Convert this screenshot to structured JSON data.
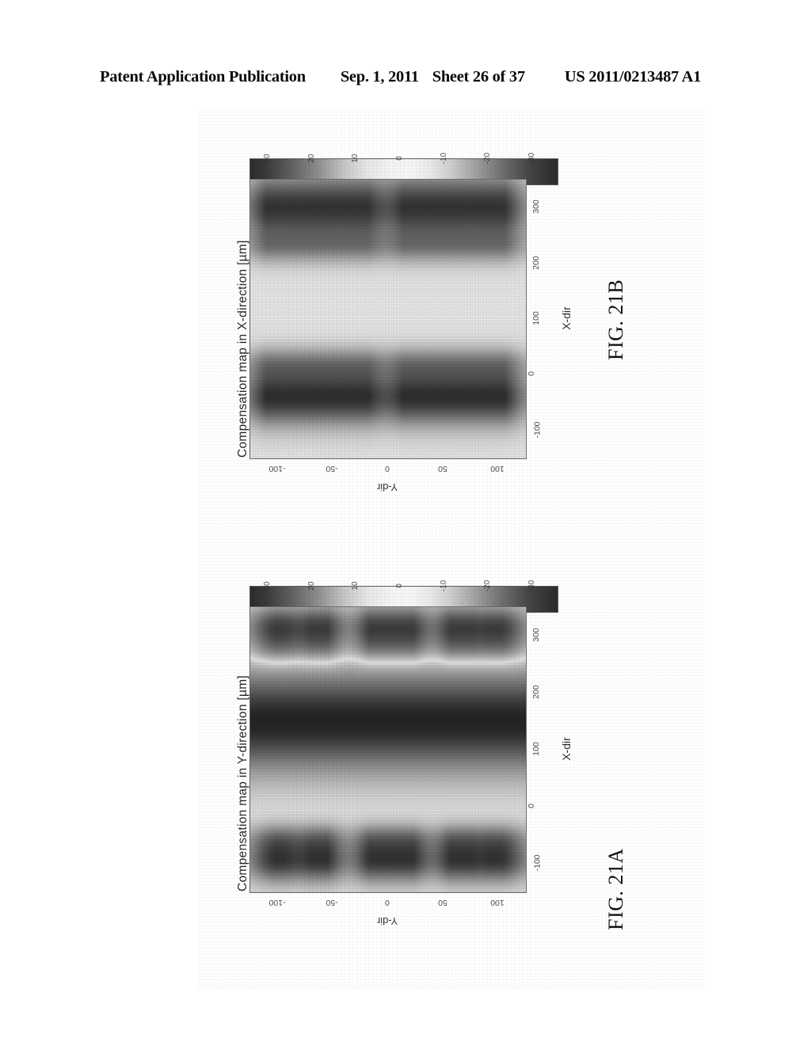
{
  "header": {
    "publication": "Patent Application Publication",
    "date": "Sep. 1, 2011",
    "sheet": "Sheet 26 of 37",
    "document_number": "US 2011/0213487 A1"
  },
  "figures": [
    {
      "id": "21B",
      "caption": "FIG. 21B",
      "title": "Compensation map in X-direction [µm]",
      "xlabel": "X-dir",
      "ylabel": "Y-dir",
      "colorbar_ticks": [
        "30",
        "20",
        "10",
        "0",
        "-10",
        "-20",
        "-30"
      ],
      "x_ticks": [
        "-100",
        "0",
        "100",
        "200",
        "300"
      ],
      "y_ticks": [
        "-100",
        "-50",
        "0",
        "50",
        "100"
      ]
    },
    {
      "id": "21A",
      "caption": "FIG. 21A",
      "title": "Compensation map in Y-direction [µm]",
      "xlabel": "X-dir",
      "ylabel": "Y-dir",
      "colorbar_ticks": [
        "30",
        "20",
        "10",
        "0",
        "-10",
        "-20",
        "-30"
      ],
      "x_ticks": [
        "-100",
        "0",
        "100",
        "200",
        "300"
      ],
      "y_ticks": [
        "-100",
        "-50",
        "0",
        "50",
        "100"
      ]
    }
  ],
  "colors": {
    "ink": "#111111",
    "paper": "#ffffff",
    "cbar_low": "#2d2d2d",
    "cbar_mid": "#f6f6f6",
    "cbar_high": "#2b2b2b"
  },
  "chart_data": [
    {
      "type": "heatmap",
      "figure": "21B",
      "title": "Compensation map in X-direction [µm]",
      "xlabel": "X-dir",
      "ylabel": "Y-dir",
      "xlim": [
        -150,
        350
      ],
      "ylim": [
        -125,
        125
      ],
      "xticks": [
        -100,
        0,
        100,
        200,
        300
      ],
      "yticks": [
        -100,
        -50,
        0,
        50,
        100
      ],
      "clim": [
        -30,
        30
      ],
      "colorbar_ticks": [
        30,
        20,
        10,
        0,
        -10,
        -20,
        -30
      ],
      "colormap": "dark-light-dark (diverging, grayscale scan)",
      "grid": false,
      "description": "Vertical bands of alternating strong compensation. Strong dark lobes form two wide vertical stripes near x=-40 and x=300, a weaker stripe near x=20 and x=230, with a near-zero (light) vertical region spanning roughly x=60 to x=200. Lobes repeat along y at approximately y=-100,-75,-50,-25,0(gap),25,50,75,100.",
      "x_blob_centers": [
        -40,
        20,
        230,
        300
      ],
      "x_blob_amplitudes": [
        -28,
        -12,
        11,
        27
      ],
      "x_blob_widths": [
        34,
        20,
        20,
        40
      ],
      "y_blob_centers": [
        -105,
        -78,
        -52,
        -26,
        22,
        48,
        74,
        100
      ],
      "y_blob_widths": [
        16,
        14,
        14,
        18,
        16,
        14,
        14,
        16
      ]
    },
    {
      "type": "heatmap",
      "figure": "21A",
      "title": "Compensation map in Y-direction [µm]",
      "xlabel": "X-dir",
      "ylabel": "Y-dir",
      "xlim": [
        -150,
        350
      ],
      "ylim": [
        -125,
        125
      ],
      "xticks": [
        -100,
        0,
        100,
        200,
        300
      ],
      "yticks": [
        -100,
        -50,
        0,
        50,
        100
      ],
      "clim": [
        -30,
        30
      ],
      "colorbar_ticks": [
        30,
        20,
        10,
        0,
        -10,
        -20,
        -30
      ],
      "colormap": "dark-light-dark (diverging, grayscale scan)",
      "grid": false,
      "description": "Horizontal bands. A very strong saturated dark horizontal band spans the full x range between about x=95 and x=205. Rows of discrete dark lobes occur near x=-95 and x=315 (edges) plus weaker lobes near x=-55 and x=275. The remaining field is near zero (light).",
      "x_band_centers": [
        -95,
        -55,
        150,
        275,
        315
      ],
      "x_band_amplitudes": [
        -26,
        -12,
        -30,
        10,
        25
      ],
      "x_band_widths": [
        26,
        18,
        58,
        18,
        26
      ],
      "y_lobe_centers": [
        -100,
        -60,
        -12,
        18,
        62,
        100
      ],
      "y_lobe_widths": [
        18,
        14,
        14,
        14,
        14,
        18
      ]
    }
  ]
}
